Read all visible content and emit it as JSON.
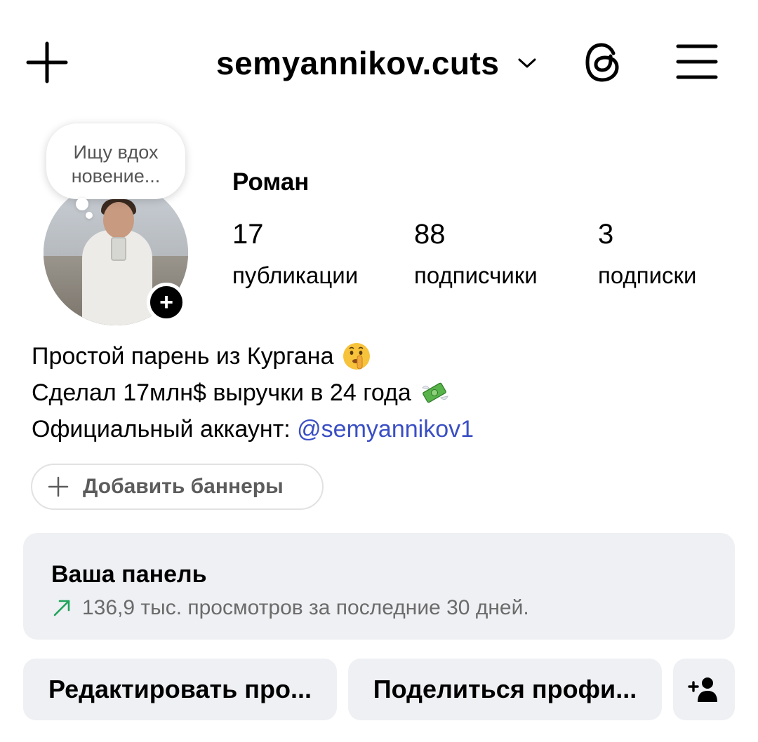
{
  "header": {
    "username": "semyannikov.cuts",
    "icons": [
      "plus-icon",
      "chevron-down-icon",
      "threads-icon",
      "hamburger-menu-icon"
    ]
  },
  "profile": {
    "note_line1": "Ищу вдох",
    "note_line2": "новение...",
    "name": "Роман",
    "stats": [
      {
        "value": "17",
        "label": "публикации"
      },
      {
        "value": "88",
        "label": "подписчики"
      },
      {
        "value": "3",
        "label": "подписки"
      }
    ]
  },
  "bio": {
    "line1": "Простой парень из Кургана",
    "line2": "Сделал 17млн$ выручки в 24 года",
    "line3_prefix": "Официальный аккаунт: ",
    "line3_link": "@semyannikov1",
    "emoji1": "shushing-face-emoji",
    "emoji2": "money-with-wings-emoji"
  },
  "banners_button": {
    "label": "Добавить баннеры"
  },
  "dashboard": {
    "title": "Ваша панель",
    "subtitle": "136,9 тыс. просмотров за последние 30 дней.",
    "accent": "#1fa35b"
  },
  "actions": {
    "edit_label": "Редактировать про...",
    "share_label": "Поделиться профи..."
  },
  "colors": {
    "link": "#3a4fc4",
    "panel_bg": "#eef0f3"
  }
}
